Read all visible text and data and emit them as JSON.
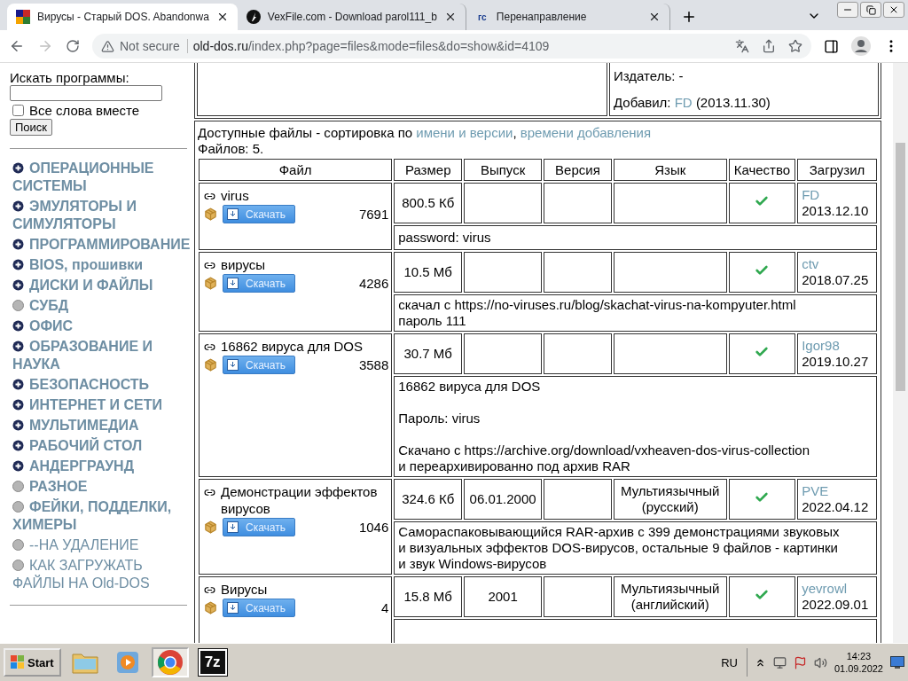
{
  "browser": {
    "tabs": [
      {
        "title": "Вирусы - Старый DOS. Abandonwa",
        "selected": true,
        "kind": "msdos"
      },
      {
        "title": "VexFile.com - Download parol111_b",
        "selected": false,
        "kind": "vexfile"
      },
      {
        "title": "Перенаправление",
        "selected": false,
        "kind": "text",
        "favicon_text": "гс"
      }
    ],
    "security": "Not secure",
    "url_host": "old-dos.ru",
    "url_path": "/index.php?page=files&mode=files&do=show&id=4109"
  },
  "sidebar": {
    "search_label": "Искать программы:",
    "all_words": {
      "label": "Все слова вместе",
      "checked": false
    },
    "search_button": "Поиск",
    "categories": [
      {
        "label": "ОПЕРАЦИОННЫЕ СИСТЕМЫ",
        "expandable": true,
        "bold": true
      },
      {
        "label": "ЭМУЛЯТОРЫ И СИМУЛЯТОРЫ",
        "expandable": true,
        "bold": true
      },
      {
        "label": "ПРОГРАММИРОВАНИЕ",
        "expandable": true,
        "bold": true
      },
      {
        "label": "BIOS, прошивки",
        "expandable": true,
        "bold": true
      },
      {
        "label": "ДИСКИ И ФАЙЛЫ",
        "expandable": true,
        "bold": true
      },
      {
        "label": "СУБД",
        "expandable": false,
        "bold": true
      },
      {
        "label": "ОФИС",
        "expandable": true,
        "bold": true
      },
      {
        "label": "ОБРАЗОВАНИЕ И НАУКА",
        "expandable": true,
        "bold": true
      },
      {
        "label": "БЕЗОПАСНОСТЬ",
        "expandable": true,
        "bold": true
      },
      {
        "label": "ИНТЕРНЕТ И СЕТИ",
        "expandable": true,
        "bold": true
      },
      {
        "label": "МУЛЬТИМЕДИА",
        "expandable": true,
        "bold": true
      },
      {
        "label": "РАБОЧИЙ СТОЛ",
        "expandable": true,
        "bold": true
      },
      {
        "label": "АНДЕРГРАУНД",
        "expandable": true,
        "bold": true
      },
      {
        "label": "РАЗНОЕ",
        "expandable": false,
        "bold": true
      },
      {
        "label": "ФЕЙКИ, ПОДДЕЛКИ, ХИМЕРЫ",
        "expandable": false,
        "bold": true
      },
      {
        "label": "--НА УДАЛЕНИЕ",
        "expandable": false,
        "bold": false
      },
      {
        "label": "КАК ЗАГРУЖАТЬ ФАЙЛЫ НА Old-DOS",
        "expandable": false,
        "bold": false
      }
    ]
  },
  "details": {
    "publisher": "Издатель: -",
    "added_label": "Добавил:",
    "added_by": "FD",
    "added_date": "(2013.11.30)"
  },
  "files": {
    "sort_label": "Доступные файлы - сортировка по",
    "sort_links": [
      "имени и версии",
      "времени добавления"
    ],
    "sort_separator": ",",
    "count": "Файлов: 5.",
    "columns": [
      "Файл",
      "Размер",
      "Выпуск",
      "Версия",
      "Язык",
      "Качество",
      "Загрузил"
    ],
    "rows": [
      {
        "download_label": "Скачать",
        "name": "virus",
        "downloads": "7691",
        "size": "800.5 Кб",
        "quality": true,
        "uploader": "FD",
        "date": "2013.12.10",
        "note": [
          [
            "password: virus"
          ]
        ]
      },
      {
        "download_label": "Скачать",
        "name": "вирусы",
        "downloads": "4286",
        "size": "10.5 Мб",
        "quality": true,
        "uploader": "ctv",
        "date": "2018.07.25",
        "note": [
          [
            "скачал с https://no-viruses.ru/blog/skachat-virus-na-kompyuter.html",
            "пароль 111"
          ]
        ]
      },
      {
        "download_label": "Скачать",
        "name": "16862 вируса для DOS",
        "downloads": "3588",
        "size": "30.7 Мб",
        "quality": true,
        "uploader": "Igor98",
        "date": "2019.10.27",
        "note": [
          [
            "16862 вируса для DOS"
          ],
          [
            "Пароль: virus"
          ],
          [
            "Скачано с https://archive.org/download/vxheaven-dos-virus-collection",
            "и переархивированно под архив RAR"
          ]
        ]
      },
      {
        "download_label": "Скачать",
        "name": "Демонстрации эффектов вирусов",
        "downloads": "1046",
        "size": "324.6 Кб",
        "release": "06.01.2000",
        "language": "Мультиязычный (русский)",
        "quality": true,
        "uploader": "PVE",
        "date": "2022.04.12",
        "note": [
          [
            "Самораспаковывающийся RAR-архив с 399 демонстрациями звуковых",
            "и визуальных эффектов DOS-вирусов, остальные 9 файлов - картинки",
            "и звук Windows-вирусов"
          ]
        ]
      },
      {
        "download_label": "Скачать",
        "name": "Вирусы",
        "downloads": "4",
        "size": "15.8 Мб",
        "release": "2001",
        "language": "Мультиязычный (английский)",
        "quality": true,
        "uploader": "yevrowl",
        "date": "2022.09.01"
      }
    ]
  },
  "taskbar": {
    "start_label": "Start",
    "apps": [
      {
        "kind": "explorer",
        "selected": false
      },
      {
        "kind": "media",
        "selected": false
      },
      {
        "kind": "chrome",
        "selected": true
      },
      {
        "kind": "archiver",
        "label": "7z",
        "selected": false
      }
    ],
    "language": "RU",
    "time": "14:23",
    "date": "01.09.2022"
  }
}
